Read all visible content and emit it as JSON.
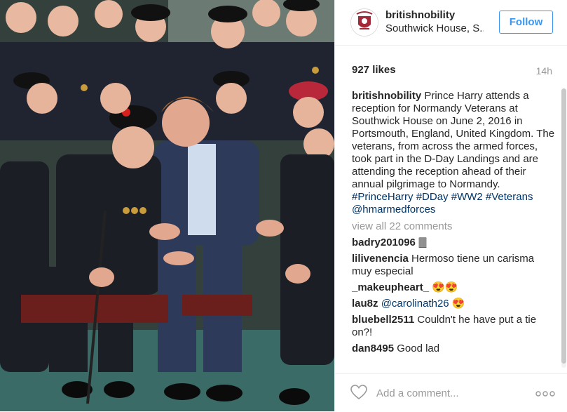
{
  "post": {
    "username": "britishnobility",
    "location": "Southwick House, S...",
    "follow_label": "Follow",
    "likes": "927 likes",
    "time_ago": "14h",
    "caption_user": "britishnobility",
    "caption_text": "Prince Harry attends a reception for Normandy Veterans at Southwick House on June 2, 2016 in Portsmouth, England, United Kingdom. The veterans, from across the armed forces, took part in the D-Day Landings and are attending the reception ahead of their annual pilgrimage to Normandy.",
    "hashtags": [
      "#PrinceHarry",
      "#DDay",
      "#WW2",
      "#Veterans"
    ],
    "mention": "@hmarmedforces",
    "view_all": "view all 22 comments",
    "comments": [
      {
        "user": "badry201096",
        "text": "🀫"
      },
      {
        "user": "lilivenencia",
        "text": "Hermoso tiene un carisma muy especial"
      },
      {
        "user": "_makeupheart_",
        "text": "😍😍"
      },
      {
        "user": "lau8z",
        "mention": "@carolinath26",
        "text": "😍"
      },
      {
        "user": "bluebell2511",
        "text": "Couldn't he have put a tie on?!"
      },
      {
        "user": "dan8495",
        "text": "Good lad"
      }
    ],
    "add_comment_placeholder": "Add a comment...",
    "more_label": "ooo"
  },
  "colors": {
    "link": "#003569",
    "follow_blue": "#3897f0",
    "muted": "#999999",
    "text": "#262626"
  },
  "icons": {
    "avatar": "crest-logo",
    "like": "heart-outline-icon",
    "more": "more-options-icon"
  }
}
